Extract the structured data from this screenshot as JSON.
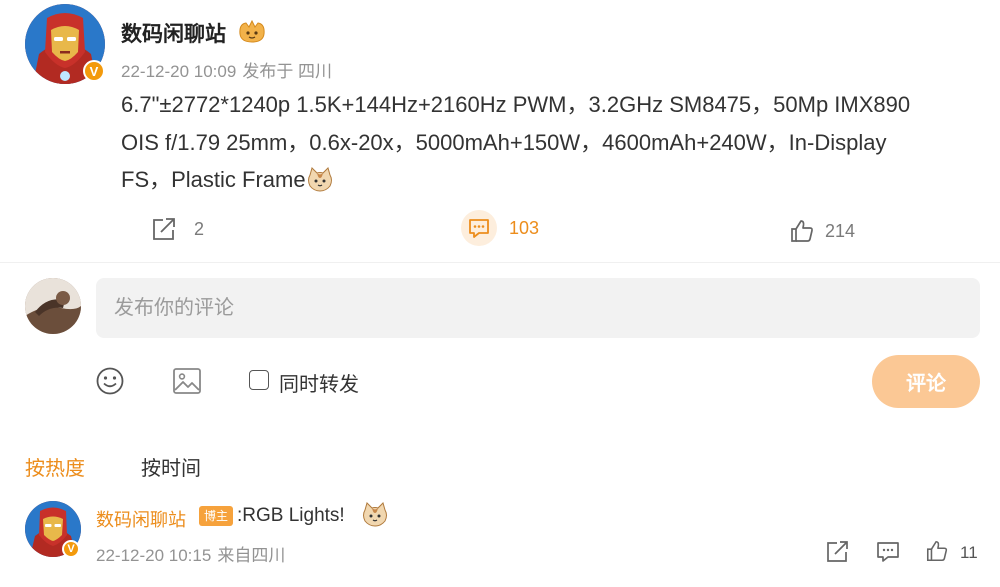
{
  "post": {
    "author": "数码闲聊站",
    "avatar_icon": "iron-man-avatar",
    "verified_badge": "V",
    "time": "22-12-20 10:09",
    "source": "发布于 四川",
    "text_lines": [
      "6.7\"±2772*1240p 1.5K+144Hz+2160Hz PWM，3.2GHz SM8475，50Mp IMX890",
      "OIS f/1.79 25mm，0.6x-20x，5000mAh+150W，4600mAh+240W，In-Display",
      "FS，Plastic Frame"
    ],
    "actions": {
      "repost_count": "2",
      "comment_count": "103",
      "like_count": "214"
    }
  },
  "composer": {
    "placeholder": "发布你的评论",
    "repost_checkbox_label": "同时转发",
    "submit_label": "评论"
  },
  "sort": {
    "hot": "按热度",
    "time": "按时间"
  },
  "comments": [
    {
      "author": "数码闲聊站",
      "badge": "博主",
      "text": ":RGB Lights!",
      "time": "22-12-20 10:15",
      "source": "来自四川",
      "like_count": "11"
    }
  ],
  "colors": {
    "accent": "#ec8d1c",
    "submit_disabled": "#fbc895",
    "input_bg": "#f2f2f2",
    "meta_text": "#939393"
  }
}
